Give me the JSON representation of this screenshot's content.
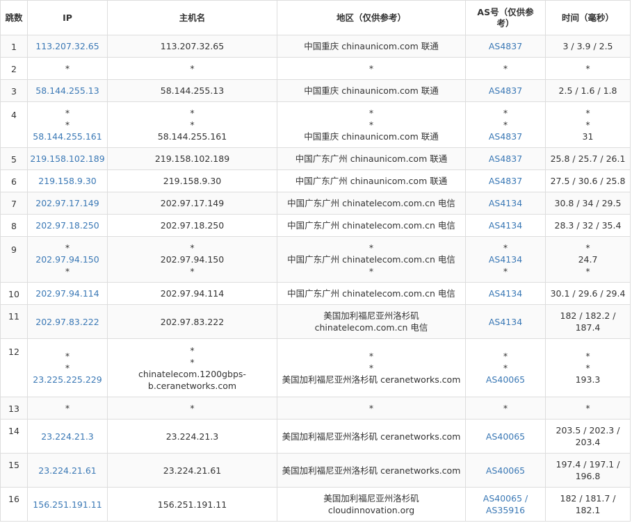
{
  "headers": {
    "hop": "跳数",
    "ip": "IP",
    "host": "主机名",
    "region": "地区（仅供参考）",
    "asn": "AS号（仅供参考）",
    "time": "时间（毫秒）"
  },
  "rows": [
    {
      "hop": "1",
      "ip": [
        "113.207.32.65"
      ],
      "host": [
        "113.207.32.65"
      ],
      "region": [
        "中国重庆 chinaunicom.com 联通"
      ],
      "asn": [
        "AS4837"
      ],
      "time": [
        "3 / 3.9 / 2.5"
      ]
    },
    {
      "hop": "2",
      "ip": [
        "*"
      ],
      "host": [
        "*"
      ],
      "region": [
        "*"
      ],
      "asn": [
        "*"
      ],
      "time": [
        "*"
      ]
    },
    {
      "hop": "3",
      "ip": [
        "58.144.255.13"
      ],
      "host": [
        "58.144.255.13"
      ],
      "region": [
        "中国重庆 chinaunicom.com 联通"
      ],
      "asn": [
        "AS4837"
      ],
      "time": [
        "2.5 / 1.6 / 1.8"
      ]
    },
    {
      "hop": "4",
      "ip": [
        "*",
        "*",
        "58.144.255.161"
      ],
      "host": [
        "*",
        "*",
        "58.144.255.161"
      ],
      "region": [
        "*",
        "*",
        "中国重庆 chinaunicom.com 联通"
      ],
      "asn": [
        "*",
        "*",
        "AS4837"
      ],
      "time": [
        "*",
        "*",
        "31"
      ]
    },
    {
      "hop": "5",
      "ip": [
        "219.158.102.189"
      ],
      "host": [
        "219.158.102.189"
      ],
      "region": [
        "中国广东广州 chinaunicom.com 联通"
      ],
      "asn": [
        "AS4837"
      ],
      "time": [
        "25.8 / 25.7 / 26.1"
      ]
    },
    {
      "hop": "6",
      "ip": [
        "219.158.9.30"
      ],
      "host": [
        "219.158.9.30"
      ],
      "region": [
        "中国广东广州 chinaunicom.com 联通"
      ],
      "asn": [
        "AS4837"
      ],
      "time": [
        "27.5 / 30.6 / 25.8"
      ]
    },
    {
      "hop": "7",
      "ip": [
        "202.97.17.149"
      ],
      "host": [
        "202.97.17.149"
      ],
      "region": [
        "中国广东广州 chinatelecom.com.cn 电信"
      ],
      "asn": [
        "AS4134"
      ],
      "time": [
        "30.8 / 34 / 29.5"
      ]
    },
    {
      "hop": "8",
      "ip": [
        "202.97.18.250"
      ],
      "host": [
        "202.97.18.250"
      ],
      "region": [
        "中国广东广州 chinatelecom.com.cn 电信"
      ],
      "asn": [
        "AS4134"
      ],
      "time": [
        "28.3 / 32 / 35.4"
      ]
    },
    {
      "hop": "9",
      "ip": [
        "*",
        "202.97.94.150",
        "*"
      ],
      "host": [
        "*",
        "202.97.94.150",
        "*"
      ],
      "region": [
        "*",
        "中国广东广州 chinatelecom.com.cn 电信",
        "*"
      ],
      "asn": [
        "*",
        "AS4134",
        "*"
      ],
      "time": [
        "*",
        "24.7",
        "*"
      ]
    },
    {
      "hop": "10",
      "ip": [
        "202.97.94.114"
      ],
      "host": [
        "202.97.94.114"
      ],
      "region": [
        "中国广东广州 chinatelecom.com.cn 电信"
      ],
      "asn": [
        "AS4134"
      ],
      "time": [
        "30.1 / 29.6 / 29.4"
      ]
    },
    {
      "hop": "11",
      "ip": [
        "202.97.83.222"
      ],
      "host": [
        "202.97.83.222"
      ],
      "region": [
        "美国加利福尼亚州洛杉矶",
        "chinatelecom.com.cn 电信"
      ],
      "asn": [
        "AS4134"
      ],
      "time": [
        "182 / 182.2 /",
        "187.4"
      ]
    },
    {
      "hop": "12",
      "ip": [
        "*",
        "*",
        "23.225.225.229"
      ],
      "host": [
        "*",
        "*",
        "chinatelecom.1200gbps-",
        "b.ceranetworks.com"
      ],
      "region": [
        "*",
        "*",
        "美国加利福尼亚州洛杉矶 ceranetworks.com"
      ],
      "asn": [
        "*",
        "*",
        "AS40065"
      ],
      "time": [
        "*",
        "*",
        "193.3"
      ]
    },
    {
      "hop": "13",
      "ip": [
        "*"
      ],
      "host": [
        "*"
      ],
      "region": [
        "*"
      ],
      "asn": [
        "*"
      ],
      "time": [
        "*"
      ]
    },
    {
      "hop": "14",
      "ip": [
        "23.224.21.3"
      ],
      "host": [
        "23.224.21.3"
      ],
      "region": [
        "美国加利福尼亚州洛杉矶 ceranetworks.com"
      ],
      "asn": [
        "AS40065"
      ],
      "time": [
        "203.5 / 202.3 /",
        "203.4"
      ]
    },
    {
      "hop": "15",
      "ip": [
        "23.224.21.61"
      ],
      "host": [
        "23.224.21.61"
      ],
      "region": [
        "美国加利福尼亚州洛杉矶 ceranetworks.com"
      ],
      "asn": [
        "AS40065"
      ],
      "time": [
        "197.4 / 197.1 /",
        "196.8"
      ]
    },
    {
      "hop": "16",
      "ip": [
        "156.251.191.11"
      ],
      "host": [
        "156.251.191.11"
      ],
      "region": [
        "美国加利福尼亚州洛杉矶",
        "cloudinnovation.org"
      ],
      "asn": [
        "AS40065 /",
        "AS35916"
      ],
      "time": [
        "182 / 181.7 /",
        "182.1"
      ]
    }
  ],
  "colors": {
    "link": "#3a78b5",
    "text": "#333333",
    "border": "#dddddd"
  }
}
